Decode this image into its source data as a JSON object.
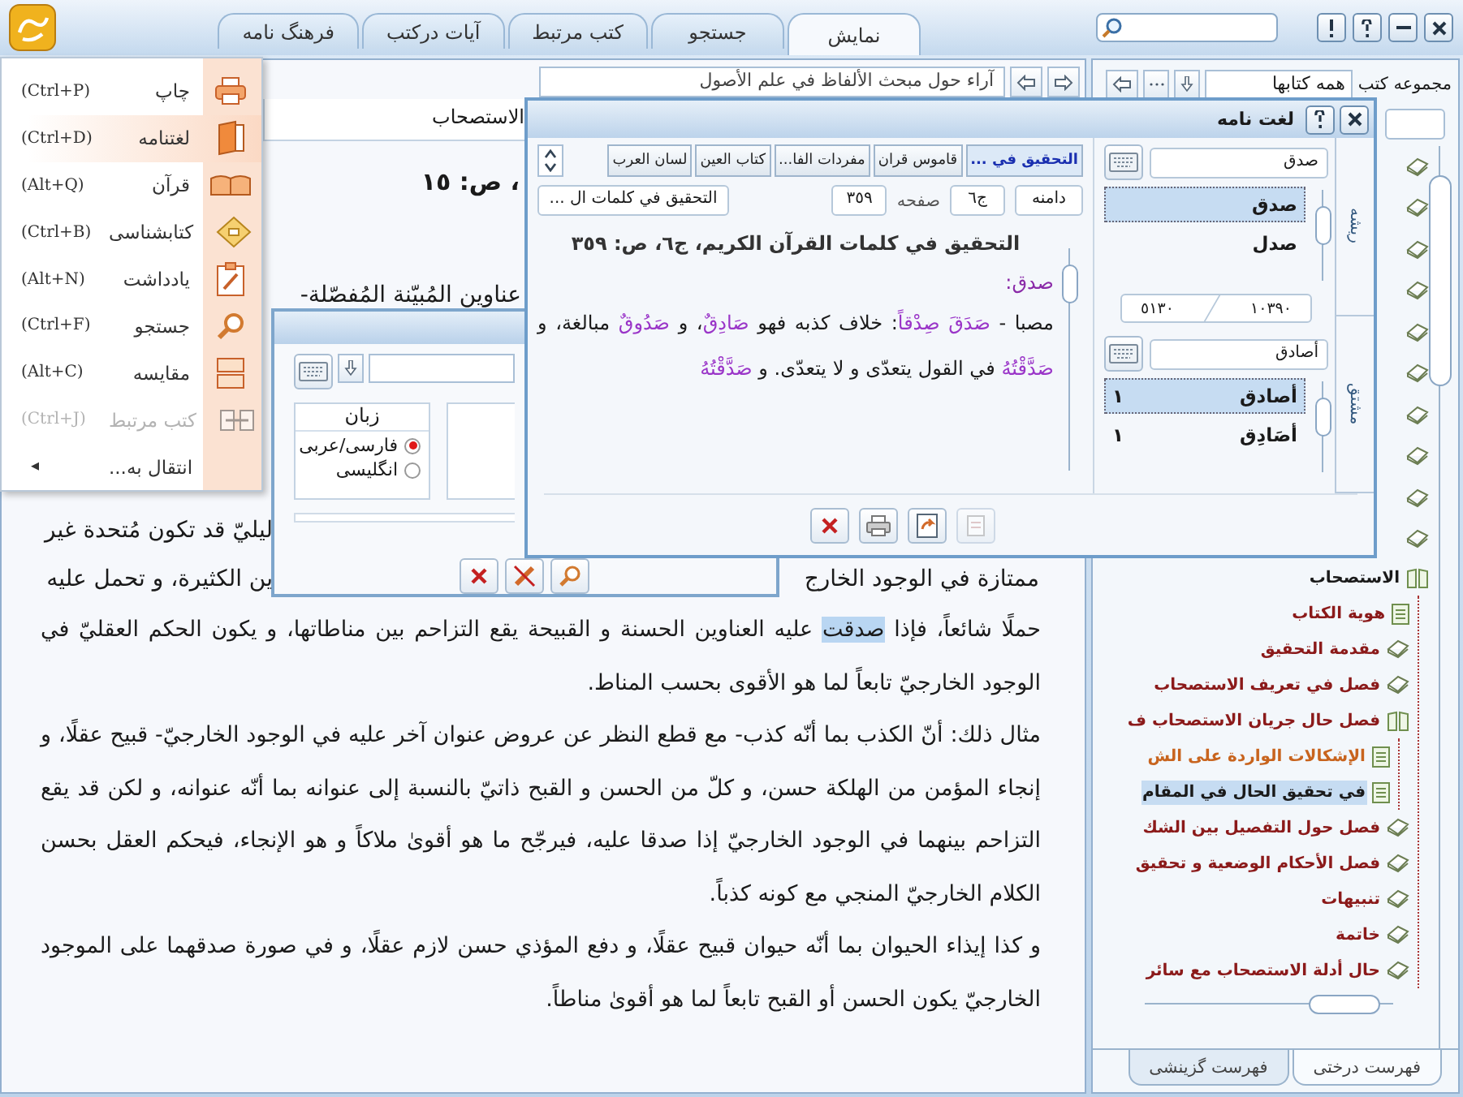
{
  "top_bar": {
    "tabs": [
      {
        "label": "نمایش",
        "selected": true
      },
      {
        "label": "جستجو",
        "selected": false
      },
      {
        "label": "کتب مرتبط",
        "selected": false
      },
      {
        "label": "آیات درکتب",
        "selected": false
      },
      {
        "label": "فرهنگ نامه",
        "selected": false
      }
    ]
  },
  "content": {
    "book_path": "آراء حول مبحث الألفاظ في علم الأصول",
    "section_title": "الاستصحاب",
    "page_ref": "، ص: ١٥",
    "cut_lines": [
      {
        "kind": "upper",
        "end": "عناوين المُبيّنة المُفصّلة-"
      },
      {
        "kind": "lower",
        "end": "ليليّ قد تكون مُتحدة غير"
      },
      {
        "kind": "lower",
        "start": "ممتازة في الوجود الخارج",
        "end": "ين الكثيرة، و تحمل عليه"
      }
    ],
    "paragraphs": [
      {
        "segments": [
          {
            "text": "حملًا شائعاً، فإذا ",
            "highlighted": false
          },
          {
            "text": "صدقت",
            "highlighted": true
          },
          {
            "text": " عليه العناوين الحسنة و القبيحة يقع التزاحم بين مناطاتها، و يكون الحكم العقليّ في الوجود الخارجيّ تابعاً لما هو الأقوى بحسب المناط.",
            "highlighted": false
          }
        ]
      },
      {
        "segments": [
          {
            "text": "مثال ذلك: أنّ الكذب بما أنّه كذب- مع قطع النظر عن عروض عنوان آخر عليه في الوجود الخارجيّ- قبيح عقلًا، و إنجاء المؤمن من الهلكة حسن، و كلّ من الحسن و القبح ذاتيّ بالنسبة إلى عنوانه بما أنّه عنوانه، و لكن قد يقع التزاحم بينهما في الوجود الخارجيّ إذا صدقا عليه، فيرجّح ما هو أقوىٰ ملاكاً و هو الإنجاء، فيحكم العقل بحسن الكلام الخارجيّ المنجي مع كونه كذباً.",
            "highlighted": false
          }
        ]
      },
      {
        "segments": [
          {
            "text": "و كذا إيذاء الحيوان بما أنّه حيوان قبيح عقلًا، و دفع المؤذي حسن لازم عقلًا، و في صورة صدقهما على الموجود الخارجيّ يكون الحسن أو القبح تابعاً لما هو أقوىٰ مناطاً.",
            "highlighted": false
          }
        ]
      }
    ]
  },
  "sidebar": {
    "collection_label": "مجموعه کتب",
    "collection_value": "همه کتابها",
    "tree": {
      "covered_items": [
        {
          "kind": "book"
        },
        {
          "kind": "book"
        },
        {
          "kind": "book"
        },
        {
          "kind": "book"
        },
        {
          "kind": "book"
        },
        {
          "kind": "book"
        },
        {
          "kind": "book"
        },
        {
          "kind": "book"
        },
        {
          "kind": "book"
        },
        {
          "kind": "book"
        }
      ],
      "items": [
        {
          "label": "الاستصحاب",
          "kind": "folder",
          "color": "#1a1a1a",
          "selected": false,
          "expanded": true,
          "children": [
            {
              "label": "هوية الكتاب",
              "kind": "page",
              "color": "#8b1a1a",
              "selected": false
            },
            {
              "label": "مقدمة التحقيق",
              "kind": "book",
              "color": "#8b1a1a",
              "selected": false
            },
            {
              "label": "فصل في تعريف الاستصحاب",
              "kind": "book",
              "color": "#8b1a1a",
              "selected": false
            },
            {
              "label": "فصل حال جريان الاستصحاب ف",
              "kind": "folder",
              "color": "#8b1a1a",
              "selected": false,
              "expanded": true,
              "children": [
                {
                  "label": "الإشكالات الواردة على الش",
                  "kind": "page",
                  "color": "#c8641e",
                  "selected": false
                },
                {
                  "label": "في تحقيق الحال في المقام",
                  "kind": "page",
                  "color": "#1a1a1a",
                  "selected": true
                }
              ]
            },
            {
              "label": "فصل حول التفصيل بين الشك",
              "kind": "book",
              "color": "#8b1a1a",
              "selected": false
            },
            {
              "label": "فصل الأحكام الوضعية و تحقيق",
              "kind": "book",
              "color": "#8b1a1a",
              "selected": false
            },
            {
              "label": "تنبيهات",
              "kind": "book",
              "color": "#8b1a1a",
              "selected": false
            },
            {
              "label": "خاتمة",
              "kind": "book",
              "color": "#8b1a1a",
              "selected": false
            },
            {
              "label": "حال أدلة الاستصحاب مع سائر",
              "kind": "book",
              "color": "#8b1a1a",
              "selected": false
            }
          ]
        }
      ]
    },
    "tabs": [
      {
        "label": "فهرست درختی",
        "selected": true
      },
      {
        "label": "فهرست گزینشی",
        "selected": false
      }
    ]
  },
  "menu": {
    "items": [
      {
        "kind": "print",
        "label": "چاپ",
        "shortcut": "(Ctrl+P)",
        "selected": false,
        "disabled": false
      },
      {
        "kind": "dictionary",
        "label": "لغتنامه",
        "shortcut": "(Ctrl+D)",
        "selected": true,
        "disabled": false
      },
      {
        "kind": "quran",
        "label": "قرآن",
        "shortcut": "(Alt+Q)",
        "selected": false,
        "disabled": false
      },
      {
        "kind": "bibliography",
        "label": "کتابشناسی",
        "shortcut": "(Ctrl+B)",
        "selected": false,
        "disabled": false
      },
      {
        "kind": "note",
        "label": "یادداشت",
        "shortcut": "(Alt+N)",
        "selected": false,
        "disabled": false
      },
      {
        "kind": "search",
        "label": "جستجو",
        "shortcut": "(Ctrl+F)",
        "selected": false,
        "disabled": false
      },
      {
        "kind": "compare",
        "label": "مقایسه",
        "shortcut": "(Alt+C)",
        "selected": false,
        "disabled": false
      },
      {
        "kind": "related",
        "label": "کتب مرتبط",
        "shortcut": "(Ctrl+J)",
        "selected": false,
        "disabled": true
      },
      {
        "kind": "submenu",
        "label": "انتقال به...",
        "arrow": "◂",
        "selected": false,
        "disabled": false
      }
    ]
  },
  "search_dialog": {
    "language_group": {
      "title": "زبان",
      "options": [
        {
          "label": "فارسی/عربی",
          "selected": true
        },
        {
          "label": "انگلیسی",
          "selected": false
        }
      ]
    }
  },
  "dictionary": {
    "title": "لغت نامه",
    "books": [
      {
        "label": "التحقيق في ...",
        "selected": true
      },
      {
        "label": "قاموس قران",
        "selected": false
      },
      {
        "label": "مفردات الفا...",
        "selected": false
      },
      {
        "label": "كتاب العين",
        "selected": false
      },
      {
        "label": "لسان العرب",
        "selected": false
      }
    ],
    "range_label": "دامنه",
    "volume": "ج٦",
    "page_label": "صفحه",
    "page": "٣٥٩",
    "book_field": "التحقيق في كلمات ال ...",
    "entry": {
      "heading": "التحقيق في كلمات القرآن الكريم، ج٦، ص: ٣٥٩",
      "headword": "صدق:",
      "segments": [
        {
          "text": "مصبا - ",
          "term": false
        },
        {
          "text": "صَدَقَ صِدْقاً",
          "term": true
        },
        {
          "text": ": خلاف كذبه فهو ",
          "term": false
        },
        {
          "text": "صَادِقٌ",
          "term": true
        },
        {
          "text": "، و ",
          "term": false
        },
        {
          "text": "صَدُوقٌ",
          "term": true
        },
        {
          "text": " مبالغة، و ",
          "term": false
        },
        {
          "text": "صَدَّقْتُهُ",
          "term": true
        },
        {
          "text": " في القول يتعدّى و لا يتعدّى. و ",
          "term": false
        },
        {
          "text": "صَدَّقْتُهُ",
          "term": true
        }
      ]
    },
    "root_tab": "ریشه",
    "derived_tab": "مشتق",
    "root_query": "صدق",
    "roots": [
      {
        "label": "صدق",
        "selected": true
      },
      {
        "label": "صدل",
        "selected": false
      }
    ],
    "range_from": "١٠٣٩٠",
    "range_to": "٥١٣٠",
    "derived_query": "أصادق",
    "derived": [
      {
        "label": "أصادق",
        "count": "١",
        "selected": true
      },
      {
        "label": "أصَادِق",
        "count": "١",
        "selected": false
      }
    ]
  }
}
